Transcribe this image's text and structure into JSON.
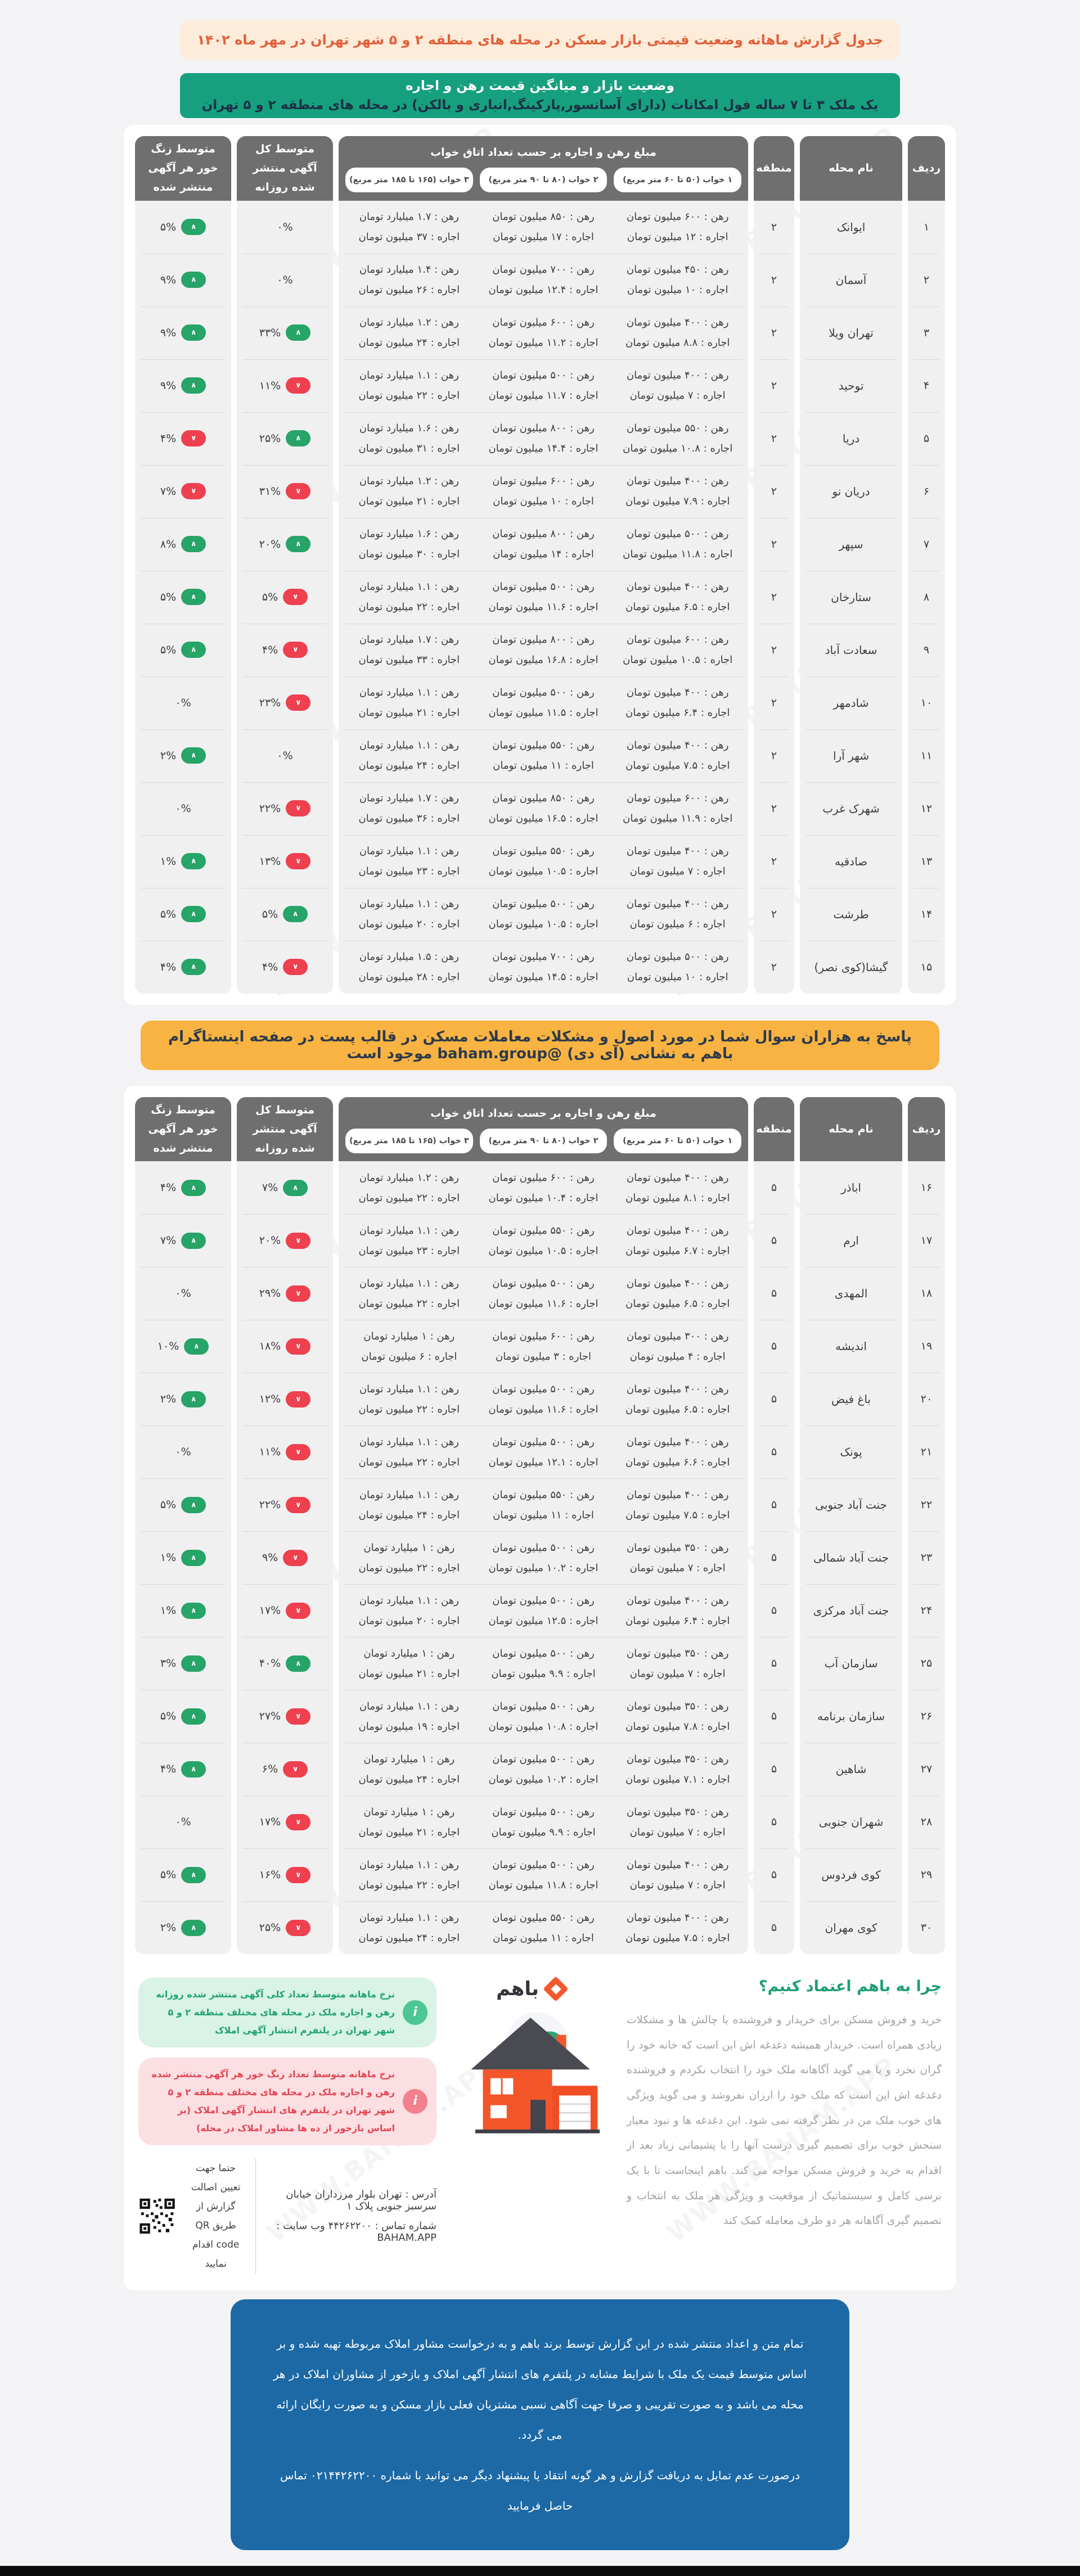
{
  "page": {
    "top_banner": "جدول گزارش ماهانه وضعیت قیمتی بازار مسکن در محله های منطقه ۲ و ۵ شهر تهران در مهر ماه ۱۴۰۲",
    "section_title": {
      "lead": "وضعیت بازار و میانگین قیمت رهن و اجاره",
      "rest": "یک ملک ۳ تا ۷ ساله فول امکانات (دارای آسانسور,پارکینگ,انباری و بالکن) در محله های منطقه ۲ و ۵ تهران"
    },
    "watermark": "WWW.BAHAM.APP",
    "mid_banner": "پاسخ به هزاران سوال شما در مورد اصول و مشکلات معاملات مسکن در قالب پست در صفحه اینستاگرام باهم به نشانی (آی دی) @baham.group موجود است",
    "colors": {
      "badge_up": "#27a468",
      "badge_down": "#ee404f",
      "section_green": "#16a07e",
      "mid_amber": "#f9b342",
      "top_cream": "#fcecd9",
      "top_text": "#e2603b",
      "disclaimer_blue": "#1c69a6",
      "brand_orange": "#f4582c",
      "header_gray": "#6f6f6f"
    }
  },
  "table": {
    "headers": {
      "row": "ردیف",
      "neighborhood": "نام محله",
      "district": "منطقه",
      "price_group": "مبلغ رهن و اجاره بر حسب تعداد اتاق خواب",
      "bedroom_cols": [
        "۱ خواب (۵۰ تا ۶۰ متر مربع)",
        "۲ خواب (۸۰ تا ۹۰ متر مربع)",
        "۳ خواب (۱۶۵ تا ۱۸۵ متر مربع)"
      ],
      "daily_ads": "متوسط کل آگهی منتشر شده روزانه",
      "ring_rate": "متوسط زنگ خور هر آگهی منتشر شده"
    },
    "labels": {
      "rahn": "رهن",
      "ejare": "اجاره"
    }
  },
  "table1_rows": [
    {
      "no": "۱",
      "name": "ایوانک",
      "district": "۲",
      "rahn": [
        "۶۰۰ میلیون تومان",
        "۸۵۰ میلیون تومان",
        "۱.۷ میلیارد تومان"
      ],
      "ejare": [
        "۱۲ میلیون تومان",
        "۱۷ میلیون تومان",
        "۳۷ میلیون تومان"
      ],
      "ads": [
        "۰%",
        null
      ],
      "ring": [
        "۵%",
        "up"
      ]
    },
    {
      "no": "۲",
      "name": "آسمان",
      "district": "۲",
      "rahn": [
        "۴۵۰ میلیون تومان",
        "۷۰۰ میلیون تومان",
        "۱.۴ میلیارد تومان"
      ],
      "ejare": [
        "۱۰ میلیون تومان",
        "۱۲.۴ میلیون تومان",
        "۲۶ میلیون تومان"
      ],
      "ads": [
        "۰%",
        null
      ],
      "ring": [
        "۹%",
        "up"
      ]
    },
    {
      "no": "۳",
      "name": "تهران ویلا",
      "district": "۲",
      "rahn": [
        "۴۰۰ میلیون تومان",
        "۶۰۰ میلیون تومان",
        "۱.۲ میلیارد تومان"
      ],
      "ejare": [
        "۸.۸ میلیون تومان",
        "۱۱.۲ میلیون تومان",
        "۲۴ میلیون تومان"
      ],
      "ads": [
        "۳۳%",
        "up"
      ],
      "ring": [
        "۹%",
        "up"
      ]
    },
    {
      "no": "۴",
      "name": "توحید",
      "district": "۲",
      "rahn": [
        "۴۰۰ میلیون تومان",
        "۵۰۰ میلیون تومان",
        "۱.۱ میلیارد تومان"
      ],
      "ejare": [
        "۷ میلیون تومان",
        "۱۱.۷ میلیون تومان",
        "۲۲ میلیون تومان"
      ],
      "ads": [
        "۱۱%",
        "down"
      ],
      "ring": [
        "۹%",
        "up"
      ]
    },
    {
      "no": "۵",
      "name": "دریا",
      "district": "۲",
      "rahn": [
        "۵۵۰ میلیون تومان",
        "۸۰۰ میلیون تومان",
        "۱.۶ میلیارد تومان"
      ],
      "ejare": [
        "۱۰.۸ میلیون تومان",
        "۱۴.۴ میلیون تومان",
        "۳۱ میلیون تومان"
      ],
      "ads": [
        "۲۵%",
        "up"
      ],
      "ring": [
        "۴%",
        "down"
      ]
    },
    {
      "no": "۶",
      "name": "دریان نو",
      "district": "۲",
      "rahn": [
        "۴۰۰ میلیون تومان",
        "۶۰۰ میلیون تومان",
        "۱.۲ میلیارد تومان"
      ],
      "ejare": [
        "۷.۹ میلیون تومان",
        "۱۰ میلیون تومان",
        "۲۱ میلیون تومان"
      ],
      "ads": [
        "۳۱%",
        "down"
      ],
      "ring": [
        "۷%",
        "down"
      ]
    },
    {
      "no": "۷",
      "name": "سپهر",
      "district": "۲",
      "rahn": [
        "۵۰۰ میلیون تومان",
        "۸۰۰ میلیون تومان",
        "۱.۶ میلیارد تومان"
      ],
      "ejare": [
        "۱۱.۸ میلیون تومان",
        "۱۴ میلیون تومان",
        "۳۰ میلیون تومان"
      ],
      "ads": [
        "۲۰%",
        "up"
      ],
      "ring": [
        "۸%",
        "up"
      ]
    },
    {
      "no": "۸",
      "name": "ستارخان",
      "district": "۲",
      "rahn": [
        "۴۰۰ میلیون تومان",
        "۵۰۰ میلیون تومان",
        "۱.۱ میلیارد تومان"
      ],
      "ejare": [
        "۶.۵ میلیون تومان",
        "۱۱.۶ میلیون تومان",
        "۲۲ میلیون تومان"
      ],
      "ads": [
        "۵%",
        "down"
      ],
      "ring": [
        "۵%",
        "up"
      ]
    },
    {
      "no": "۹",
      "name": "سعادت آباد",
      "district": "۲",
      "rahn": [
        "۶۰۰ میلیون تومان",
        "۸۰۰ میلیون تومان",
        "۱.۷ میلیارد تومان"
      ],
      "ejare": [
        "۱۰.۵ میلیون تومان",
        "۱۶.۸ میلیون تومان",
        "۳۳ میلیون تومان"
      ],
      "ads": [
        "۴%",
        "down"
      ],
      "ring": [
        "۵%",
        "up"
      ]
    },
    {
      "no": "۱۰",
      "name": "شادمهر",
      "district": "۲",
      "rahn": [
        "۴۰۰ میلیون تومان",
        "۵۰۰ میلیون تومان",
        "۱.۱ میلیارد تومان"
      ],
      "ejare": [
        "۶.۴ میلیون تومان",
        "۱۱.۵ میلیون تومان",
        "۲۱ میلیون تومان"
      ],
      "ads": [
        "۲۳%",
        "down"
      ],
      "ring": [
        "۰%",
        null
      ]
    },
    {
      "no": "۱۱",
      "name": "شهر آرا",
      "district": "۲",
      "rahn": [
        "۴۰۰ میلیون تومان",
        "۵۵۰ میلیون تومان",
        "۱.۱ میلیارد تومان"
      ],
      "ejare": [
        "۷.۵ میلیون تومان",
        "۱۱ میلیون تومان",
        "۲۴ میلیون تومان"
      ],
      "ads": [
        "۰%",
        null
      ],
      "ring": [
        "۲%",
        "up"
      ]
    },
    {
      "no": "۱۲",
      "name": "شهرک غرب",
      "district": "۲",
      "rahn": [
        "۶۰۰ میلیون تومان",
        "۸۵۰ میلیون تومان",
        "۱.۷ میلیارد تومان"
      ],
      "ejare": [
        "۱۱.۹ میلیون تومان",
        "۱۶.۵ میلیون تومان",
        "۳۶ میلیون تومان"
      ],
      "ads": [
        "۲۲%",
        "down"
      ],
      "ring": [
        "۰%",
        null
      ]
    },
    {
      "no": "۱۳",
      "name": "صادقیه",
      "district": "۲",
      "rahn": [
        "۴۰۰ میلیون تومان",
        "۵۵۰ میلیون تومان",
        "۱.۱ میلیارد تومان"
      ],
      "ejare": [
        "۷ میلیون تومان",
        "۱۰.۵ میلیون تومان",
        "۲۳ میلیون تومان"
      ],
      "ads": [
        "۱۳%",
        "down"
      ],
      "ring": [
        "۱%",
        "up"
      ]
    },
    {
      "no": "۱۴",
      "name": "طرشت",
      "district": "۲",
      "rahn": [
        "۴۰۰ میلیون تومان",
        "۵۰۰ میلیون تومان",
        "۱.۱ میلیارد تومان"
      ],
      "ejare": [
        "۶ میلیون تومان",
        "۱۰.۵ میلیون تومان",
        "۲۰ میلیون تومان"
      ],
      "ads": [
        "۵%",
        "up"
      ],
      "ring": [
        "۵%",
        "up"
      ]
    },
    {
      "no": "۱۵",
      "name": "گیشا(کوی نصر)",
      "district": "۲",
      "rahn": [
        "۵۰۰ میلیون تومان",
        "۷۰۰ میلیون تومان",
        "۱.۵ میلیارد تومان"
      ],
      "ejare": [
        "۱۰ میلیون تومان",
        "۱۴.۵ میلیون تومان",
        "۲۸ میلیون تومان"
      ],
      "ads": [
        "۴%",
        "down"
      ],
      "ring": [
        "۴%",
        "up"
      ]
    }
  ],
  "table2_rows": [
    {
      "no": "۱۶",
      "name": "اباذر",
      "district": "۵",
      "rahn": [
        "۴۰۰ میلیون تومان",
        "۶۰۰ میلیون تومان",
        "۱.۲ میلیارد تومان"
      ],
      "ejare": [
        "۸.۱ میلیون تومان",
        "۱۰.۴ میلیون تومان",
        "۲۲ میلیون تومان"
      ],
      "ads": [
        "۷%",
        "up"
      ],
      "ring": [
        "۴%",
        "up"
      ]
    },
    {
      "no": "۱۷",
      "name": "ارم",
      "district": "۵",
      "rahn": [
        "۴۰۰ میلیون تومان",
        "۵۵۰ میلیون تومان",
        "۱.۱ میلیارد تومان"
      ],
      "ejare": [
        "۶.۷ میلیون تومان",
        "۱۰.۵ میلیون تومان",
        "۲۳ میلیون تومان"
      ],
      "ads": [
        "۲۰%",
        "down"
      ],
      "ring": [
        "۷%",
        "up"
      ]
    },
    {
      "no": "۱۸",
      "name": "المهدی",
      "district": "۵",
      "rahn": [
        "۴۰۰ میلیون تومان",
        "۵۰۰ میلیون تومان",
        "۱.۱ میلیارد تومان"
      ],
      "ejare": [
        "۶.۵ میلیون تومان",
        "۱۱.۶ میلیون تومان",
        "۲۲ میلیون تومان"
      ],
      "ads": [
        "۲۹%",
        "down"
      ],
      "ring": [
        "۰%",
        null
      ]
    },
    {
      "no": "۱۹",
      "name": "اندیشه",
      "district": "۵",
      "rahn": [
        "۳۰۰ میلیون تومان",
        "۶۰۰ میلیون تومان",
        "۱ میلیارد تومان"
      ],
      "ejare": [
        "۴ میلیون تومان",
        "۳ میلیون تومان",
        "۶ میلیون تومان"
      ],
      "ads": [
        "۱۸%",
        "down"
      ],
      "ring": [
        "۱۰%",
        "up"
      ]
    },
    {
      "no": "۲۰",
      "name": "باغ فیض",
      "district": "۵",
      "rahn": [
        "۴۰۰ میلیون تومان",
        "۵۰۰ میلیون تومان",
        "۱.۱ میلیارد تومان"
      ],
      "ejare": [
        "۶.۵ میلیون تومان",
        "۱۱.۶ میلیون تومان",
        "۲۲ میلیون تومان"
      ],
      "ads": [
        "۱۲%",
        "down"
      ],
      "ring": [
        "۲%",
        "up"
      ]
    },
    {
      "no": "۲۱",
      "name": "پونک",
      "district": "۵",
      "rahn": [
        "۴۰۰ میلیون تومان",
        "۵۰۰ میلیون تومان",
        "۱.۱ میلیارد تومان"
      ],
      "ejare": [
        "۶.۶ میلیون تومان",
        "۱۲.۱ میلیون تومان",
        "۲۲ میلیون تومان"
      ],
      "ads": [
        "۱۱%",
        "down"
      ],
      "ring": [
        "۰%",
        null
      ]
    },
    {
      "no": "۲۲",
      "name": "جنت آباد جنوبی",
      "district": "۵",
      "rahn": [
        "۴۰۰ میلیون تومان",
        "۵۵۰ میلیون تومان",
        "۱.۱ میلیارد تومان"
      ],
      "ejare": [
        "۷.۵ میلیون تومان",
        "۱۱ میلیون تومان",
        "۲۴ میلیون تومان"
      ],
      "ads": [
        "۲۲%",
        "down"
      ],
      "ring": [
        "۵%",
        "up"
      ]
    },
    {
      "no": "۲۳",
      "name": "جنت آباد شمالی",
      "district": "۵",
      "rahn": [
        "۳۵۰ میلیون تومان",
        "۵۰۰ میلیون تومان",
        "۱ میلیارد تومان"
      ],
      "ejare": [
        "۷ میلیون تومان",
        "۱۰.۲ میلیون تومان",
        "۲۲ میلیون تومان"
      ],
      "ads": [
        "۹%",
        "down"
      ],
      "ring": [
        "۱%",
        "up"
      ]
    },
    {
      "no": "۲۴",
      "name": "جنت آباد مرکزی",
      "district": "۵",
      "rahn": [
        "۴۰۰ میلیون تومان",
        "۵۰۰ میلیون تومان",
        "۱.۱ میلیارد تومان"
      ],
      "ejare": [
        "۶.۴ میلیون تومان",
        "۱۲.۵ میلیون تومان",
        "۲۰ میلیون تومان"
      ],
      "ads": [
        "۱۷%",
        "down"
      ],
      "ring": [
        "۱%",
        "up"
      ]
    },
    {
      "no": "۲۵",
      "name": "سازمان آب",
      "district": "۵",
      "rahn": [
        "۳۵۰ میلیون تومان",
        "۵۰۰ میلیون تومان",
        "۱ میلیارد تومان"
      ],
      "ejare": [
        "۷ میلیون تومان",
        "۹.۹ میلیون تومان",
        "۲۱ میلیون تومان"
      ],
      "ads": [
        "۴۰%",
        "up"
      ],
      "ring": [
        "۳%",
        "up"
      ]
    },
    {
      "no": "۲۶",
      "name": "سازمان برنامه",
      "district": "۵",
      "rahn": [
        "۳۵۰ میلیون تومان",
        "۵۰۰ میلیون تومان",
        "۱.۱ میلیارد تومان"
      ],
      "ejare": [
        "۷.۸ میلیون تومان",
        "۱۰.۸ میلیون تومان",
        "۱۹ میلیون تومان"
      ],
      "ads": [
        "۲۷%",
        "down"
      ],
      "ring": [
        "۵%",
        "up"
      ]
    },
    {
      "no": "۲۷",
      "name": "شاهین",
      "district": "۵",
      "rahn": [
        "۳۵۰ میلیون تومان",
        "۵۰۰ میلیون تومان",
        "۱ میلیارد تومان"
      ],
      "ejare": [
        "۷.۱ میلیون تومان",
        "۱۰.۲ میلیون تومان",
        "۲۴ میلیون تومان"
      ],
      "ads": [
        "۶%",
        "down"
      ],
      "ring": [
        "۴%",
        "up"
      ]
    },
    {
      "no": "۲۸",
      "name": "شهران جنوبی",
      "district": "۵",
      "rahn": [
        "۳۵۰ میلیون تومان",
        "۵۰۰ میلیون تومان",
        "۱ میلیارد تومان"
      ],
      "ejare": [
        "۷ میلیون تومان",
        "۹.۹ میلیون تومان",
        "۲۱ میلیون تومان"
      ],
      "ads": [
        "۱۷%",
        "down"
      ],
      "ring": [
        "۰%",
        null
      ]
    },
    {
      "no": "۲۹",
      "name": "کوی فردوس",
      "district": "۵",
      "rahn": [
        "۴۰۰ میلیون تومان",
        "۵۰۰ میلیون تومان",
        "۱.۱ میلیارد تومان"
      ],
      "ejare": [
        "۷ میلیون تومان",
        "۱۱.۸ میلیون تومان",
        "۲۲ میلیون تومان"
      ],
      "ads": [
        "۱۶%",
        "down"
      ],
      "ring": [
        "۵%",
        "up"
      ]
    },
    {
      "no": "۳۰",
      "name": "کوی مهران",
      "district": "۵",
      "rahn": [
        "۴۰۰ میلیون تومان",
        "۵۵۰ میلیون تومان",
        "۱.۱ میلیارد تومان"
      ],
      "ejare": [
        "۷.۵ میلیون تومان",
        "۱۱ میلیون تومان",
        "۲۴ میلیون تومان"
      ],
      "ads": [
        "۲۵%",
        "down"
      ],
      "ring": [
        "۲%",
        "up"
      ]
    }
  ],
  "footer": {
    "why_title": "چرا به باهم اعتماد کنیم؟",
    "why_text": "خرید و فروش مسکن برای خریدار و فروشنده با چالش ها و مشکلات زیادی همراه است. خریدار همیشه دغدغه اش این است که خانه خود را گران نخرد و یا می گوید آگاهانه ملک خود را انتخاب نکردم و فروشنده دغدغه اش این است که ملک خود را ارزان نفروشد و می گوید ویژگی های خوب ملک من در نظر گرفته نمی شود. این دغدغه ها و نبود معیار سنجش خوب برای تصمیم گیری درست آنها را با پشیمانی زیاد بعد از اقدام به خرید و فروش مسکن مواجه می کند. باهم اینجاست تا با یک برسی کامل و سیستماتیک از موقعیت و ویژگی هر ملک به انتخاب و تصمیم گیری آگاهانه هر دو طرف معامله کمک کند",
    "brand": "باهم",
    "info_green": "نرخ ماهانه متوسط تعداد کلی آگهی منتشر شده روزانه رهن و اجاره ملک در محله های مختلف منطقه ۲ و ۵ شهر تهران در پلتفرم انتشار آگهی املاک",
    "info_red": "نرخ ماهانه متوسط تعداد زنگ خور هر آگهی منتشر شده رهن و اجاره ملک در محله های مختلف منطقه ۲ و ۵ شهر تهران در پلتفرم های انتشار آگهی املاک (بر اساس بازخور از ده ها مشاور املاک در محله)",
    "info_icon": "i",
    "qr_note": "حتما جهت تعیین اصالت گزارش از طریق QR code اقدام نمایید",
    "address": "آدرس : تهران بلوار مرزداران خیابان سرسبز جنوبی پلاک ۱",
    "contact": "شماره تماس : ۴۴۲۶۲۲۰۰ وب سایت : BAHAM.APP",
    "disclaimer1": "تمام متن و اعداد منتشر شده در این گزارش توسط برند باهم و به درخواست مشاور املاک مربوطه تهیه شده و بر اساس متوسط قیمت یک ملک با شرایط مشابه در پلتفرم های انتشار آگهی املاک و بازخور از مشاوران املاک در هر محله می باشد و به صورت تقریبی و صرفا جهت آگاهی نسبی مشتریان فعلی بازار مسکن و به صورت رایگان ارائه می گردد.",
    "disclaimer2": "درصورت عدم تمایل به دریافت گزارش و هر گونه انتقاد یا پیشنهاد دیگر می توانید با شماره ۰۲۱۴۴۲۶۲۲۰۰ تماس حاصل فرمایید"
  }
}
